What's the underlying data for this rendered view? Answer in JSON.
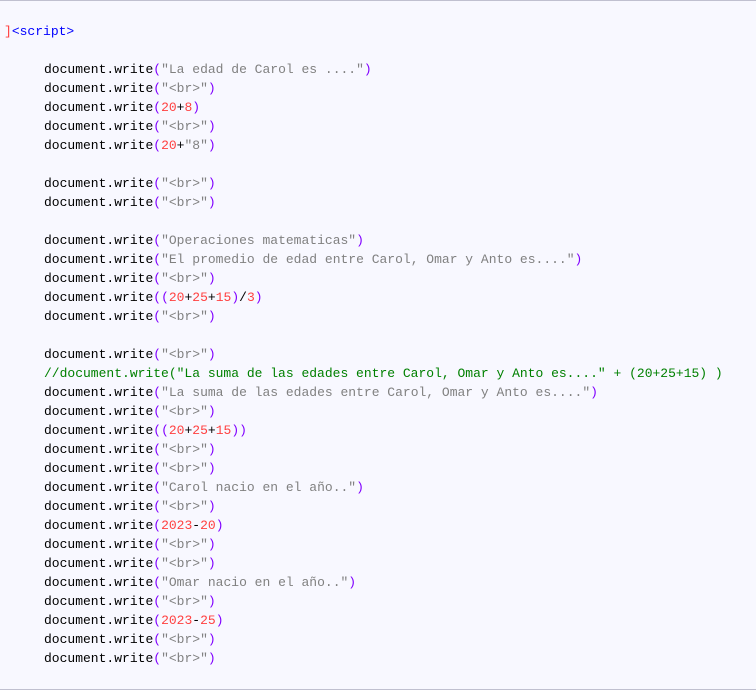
{
  "tag_open": "<script>",
  "margin_char": "]",
  "lines": [
    {
      "kind": "strcall",
      "str": "La edad de Carol es ...."
    },
    {
      "kind": "strcall",
      "str": "<br>"
    },
    {
      "kind": "numplus",
      "a": "20",
      "op": "+",
      "b": "8"
    },
    {
      "kind": "strcall",
      "str": "<br>"
    },
    {
      "kind": "numplusstr",
      "a": "20",
      "op": "+",
      "b": "\"8\""
    },
    {
      "kind": "blank"
    },
    {
      "kind": "strcall",
      "str": "<br>"
    },
    {
      "kind": "strcall",
      "str": "<br>"
    },
    {
      "kind": "blank"
    },
    {
      "kind": "strcall",
      "str": "Operaciones matematicas"
    },
    {
      "kind": "strcall",
      "str": "El promedio de edad entre Carol, Omar y Anto es...."
    },
    {
      "kind": "strcall",
      "str": "<br>"
    },
    {
      "kind": "avg",
      "a": "20",
      "b": "25",
      "c": "15",
      "d": "3"
    },
    {
      "kind": "strcall",
      "str": "<br>"
    },
    {
      "kind": "blank"
    },
    {
      "kind": "strcall",
      "str": "<br>"
    },
    {
      "kind": "comment",
      "text": "//document.write(\"La suma de las edades entre Carol, Omar y Anto es....\" + (20+25+15) )"
    },
    {
      "kind": "strcall_trail",
      "str": "La suma de las edades entre Carol, Omar y Anto es...."
    },
    {
      "kind": "strcall",
      "str": "<br>"
    },
    {
      "kind": "sum3",
      "a": "20",
      "b": "25",
      "c": "15"
    },
    {
      "kind": "strcall",
      "str": "<br>"
    },
    {
      "kind": "strcall",
      "str": "<br>"
    },
    {
      "kind": "strcall_trail",
      "str": "Carol nacio en el año.."
    },
    {
      "kind": "strcall",
      "str": "<br>"
    },
    {
      "kind": "numminus",
      "a": "2023",
      "op": "-",
      "b": "20"
    },
    {
      "kind": "strcall",
      "str": "<br>"
    },
    {
      "kind": "strcall",
      "str": "<br>"
    },
    {
      "kind": "strcall_trail",
      "str": "Omar nacio en el año.."
    },
    {
      "kind": "strcall",
      "str": "<br>"
    },
    {
      "kind": "numminus",
      "a": "2023",
      "op": "-",
      "b": "25"
    },
    {
      "kind": "strcall",
      "str": "<br>"
    },
    {
      "kind": "strcall",
      "str": "<br>"
    }
  ],
  "prefix": "document",
  "dot": ".",
  "method": "write"
}
